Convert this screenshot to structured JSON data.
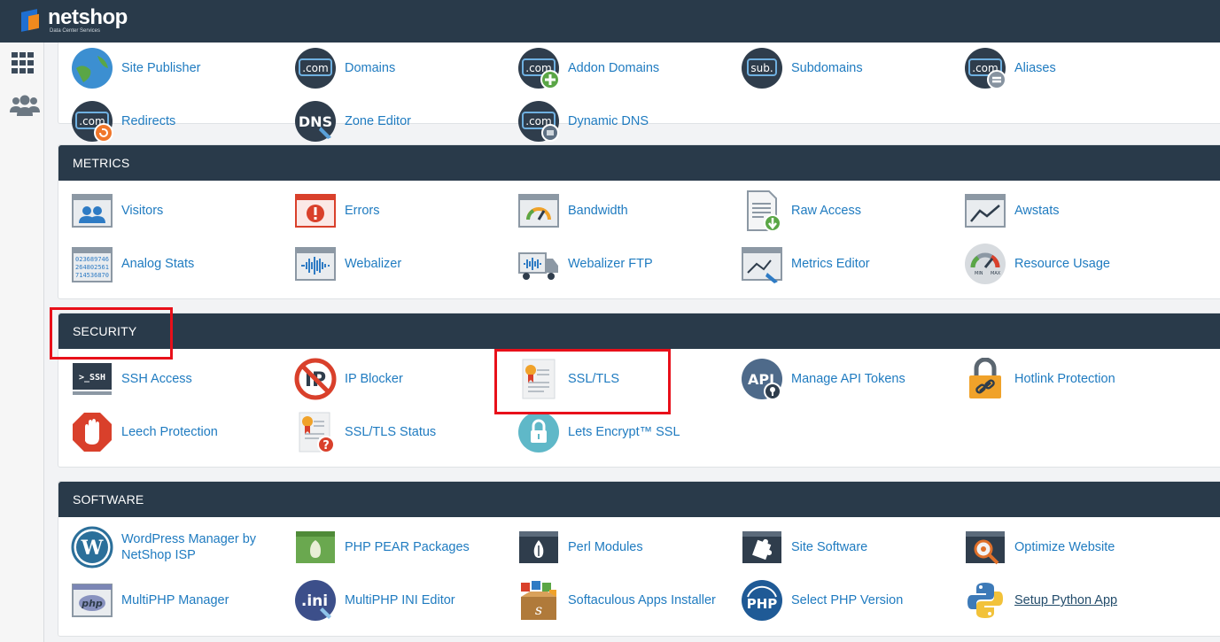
{
  "brand": {
    "name": "netshop",
    "tagline": "Data Center Services"
  },
  "sidebar": {
    "items": [
      {
        "icon": "grid-icon"
      },
      {
        "icon": "users-icon"
      }
    ]
  },
  "domains_partial": {
    "row0": [
      "Site Publisher",
      "Domains",
      "Addon Domains",
      "Subdomains",
      "Aliases"
    ],
    "row1": [
      "Redirects",
      "Zone Editor",
      "Dynamic DNS"
    ]
  },
  "metrics": {
    "title": "METRICS",
    "items": [
      "Visitors",
      "Errors",
      "Bandwidth",
      "Raw Access",
      "Awstats",
      "Analog Stats",
      "Webalizer",
      "Webalizer FTP",
      "Metrics Editor",
      "Resource Usage"
    ]
  },
  "security": {
    "title": "SECURITY",
    "items": [
      "SSH Access",
      "IP Blocker",
      "SSL/TLS",
      "Manage API Tokens",
      "Hotlink Protection",
      "Leech Protection",
      "SSL/TLS Status",
      "Lets Encrypt™ SSL"
    ]
  },
  "software": {
    "title": "SOFTWARE",
    "items": [
      "WordPress Manager by NetShop ISP",
      "PHP PEAR Packages",
      "Perl Modules",
      "Site Software",
      "Optimize Website",
      "MultiPHP Manager",
      "MultiPHP INI Editor",
      "Softaculous Apps Installer",
      "Select PHP Version",
      "Setup Python App"
    ]
  },
  "icon_texts": {
    "com": ".com",
    "sub": "sub.",
    "dns": "DNS",
    "ssh": ">_SSH",
    "api": "API",
    "php": "php",
    "ini": ".ini",
    "PHP": "PHP",
    "analog": [
      "023689746",
      "264802561",
      "714536870"
    ],
    "min": "MIN",
    "max": "MAX"
  },
  "colors": {
    "header": "#293a4a",
    "link": "#1f7bc0",
    "highlight": "#e8101a"
  }
}
